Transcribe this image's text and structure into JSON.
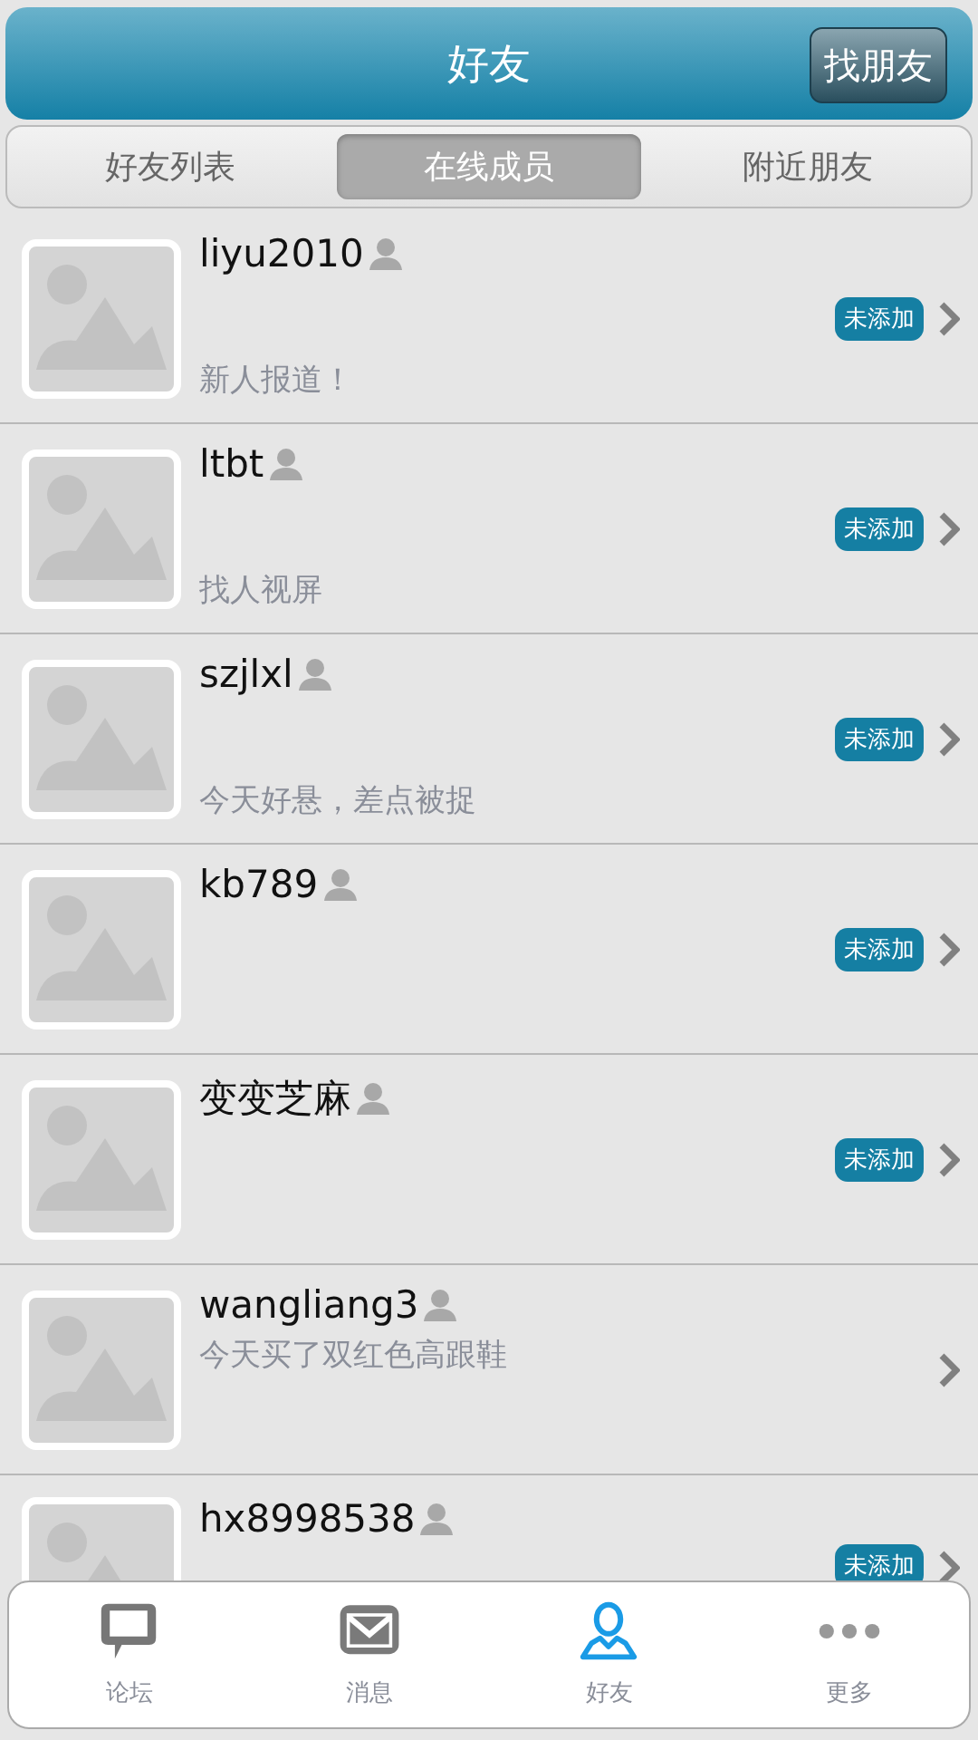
{
  "header": {
    "title": "好友",
    "action": "找朋友"
  },
  "tabs": [
    {
      "label": "好友列表",
      "selected": false
    },
    {
      "label": "在线成员",
      "selected": true
    },
    {
      "label": "附近朋友",
      "selected": false
    }
  ],
  "members": [
    {
      "name": "liyu2010",
      "status": "新人报道！",
      "badge": "未添加"
    },
    {
      "name": "ltbt",
      "status": "找人视屏",
      "badge": "未添加"
    },
    {
      "name": "szjlxl",
      "status": "今天好悬，差点被捉",
      "badge": "未添加"
    },
    {
      "name": "kb789",
      "badge": "未添加"
    },
    {
      "name": "变变芝麻",
      "badge": "未添加"
    },
    {
      "name": "wangliang3",
      "status": "今天买了双红色高跟鞋"
    },
    {
      "name": "hx8998538",
      "badge": "未添加"
    }
  ],
  "bottom_nav": [
    {
      "label": "论坛",
      "selected": false
    },
    {
      "label": "消息",
      "selected": false
    },
    {
      "label": "好友",
      "selected": true
    },
    {
      "label": "更多",
      "selected": false
    }
  ]
}
